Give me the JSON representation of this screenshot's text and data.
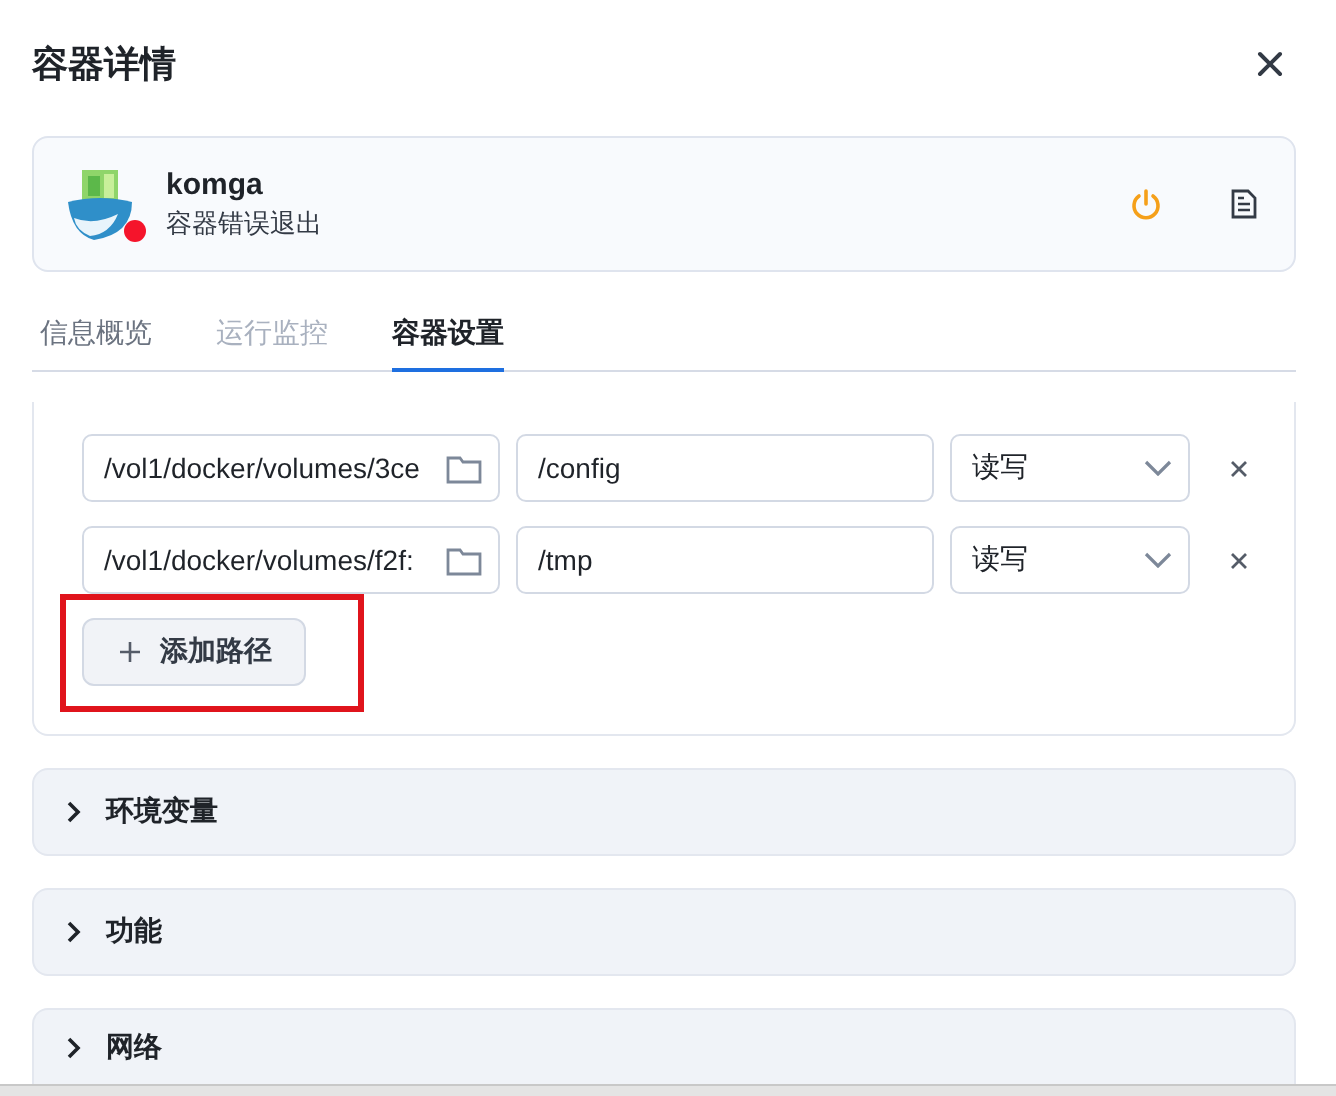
{
  "dialog": {
    "title": "容器详情"
  },
  "container": {
    "name": "komga",
    "status": "容器错误退出",
    "color": "#f5142b"
  },
  "tabs": [
    {
      "label": "信息概览",
      "selected": false,
      "disabled": false
    },
    {
      "label": "运行监控",
      "selected": false,
      "disabled": true
    },
    {
      "label": "容器设置",
      "selected": true,
      "disabled": false
    }
  ],
  "volumes": [
    {
      "host_path": "/vol1/docker/volumes/3ce",
      "container_path": "/config",
      "mode": "读写"
    },
    {
      "host_path": "/vol1/docker/volumes/f2f:",
      "container_path": "/tmp",
      "mode": "读写"
    }
  ],
  "add_path_button": {
    "label": "添加路径",
    "highlighted": true
  },
  "sections": [
    {
      "title": "环境变量",
      "expanded": false
    },
    {
      "title": "功能",
      "expanded": false
    },
    {
      "title": "网络",
      "expanded": false
    }
  ]
}
